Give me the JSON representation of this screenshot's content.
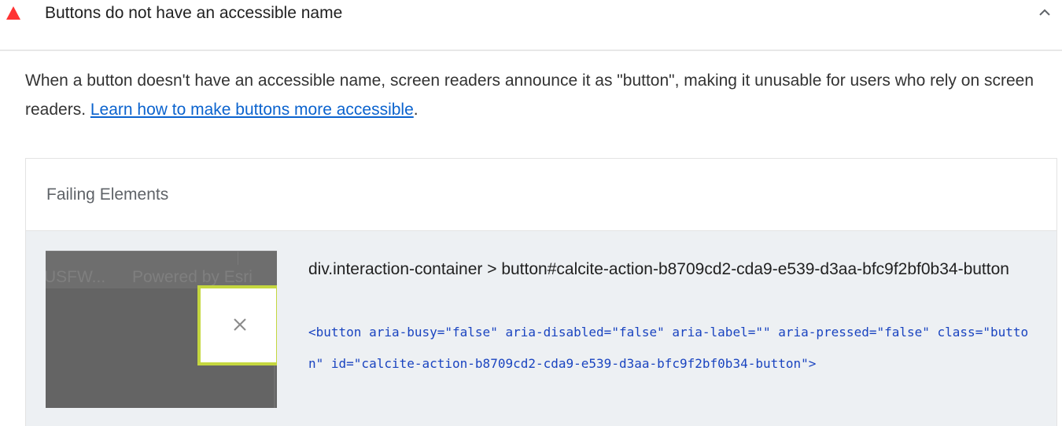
{
  "audit": {
    "title": "Buttons do not have an accessible name",
    "status_icon": "fail-triangle-icon",
    "status_color": "#ff3333",
    "description_text": "When a button doesn't have an accessible name, screen readers announce it as \"button\", making it unusable for users who rely on screen readers. ",
    "learn_more_label": "Learn how to make buttons more accessible",
    "description_end": ".",
    "collapse_icon": "chevron-up-icon"
  },
  "failing_elements": {
    "header": "Failing Elements",
    "items": [
      {
        "selector": "div.interaction-container > button#calcite-action-b8709cd2-cda9-e539-d3aa-bfc9f2bf0b34-button",
        "snippet": "<button aria-busy=\"false\" aria-disabled=\"false\" aria-label=\"\" aria-pressed=\"false\" class=\"button\" id=\"calcite-action-b8709cd2-cda9-e539-d3aa-bfc9f2bf0b34-button\">",
        "thumbnail": {
          "text_left": "USFW...",
          "text_right": "Powered by Esri",
          "highlight_color": "#c5d73f",
          "icon": "close-x-icon"
        }
      }
    ]
  },
  "colors": {
    "link": "#0b63ce",
    "snippet": "#1a44c0",
    "row_background": "#edf0f3"
  }
}
